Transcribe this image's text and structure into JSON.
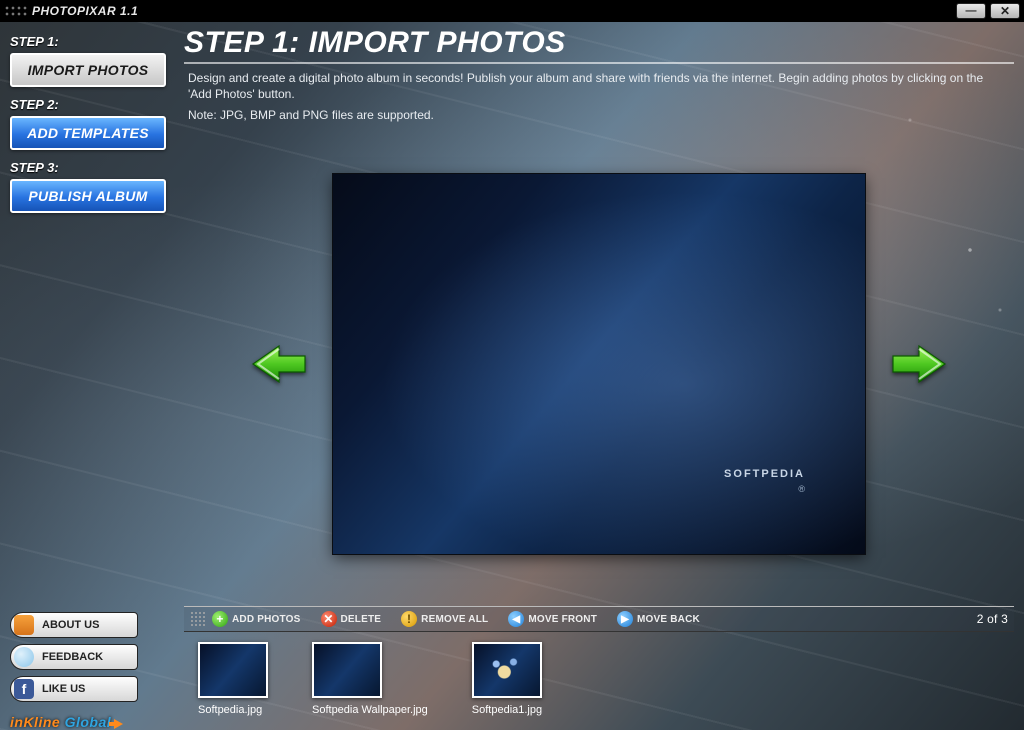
{
  "app_title": "PHOTOPIXAR 1.1",
  "sidebar": {
    "step1_label": "STEP 1:",
    "step1_btn": "IMPORT PHOTOS",
    "step2_label": "STEP 2:",
    "step2_btn": "ADD TEMPLATES",
    "step3_label": "STEP 3:",
    "step3_btn": "PUBLISH  ALBUM",
    "links": {
      "about": "ABOUT US",
      "feedback": "FEEDBACK",
      "like": "LIKE US"
    },
    "logo": {
      "part1": "inKline",
      "part2": "Global"
    }
  },
  "main": {
    "heading": "STEP 1: IMPORT PHOTOS",
    "desc": "Design and create a digital photo album in seconds! Publish your album and share with friends via the internet. Begin adding photos by clicking on the 'Add Photos' button.",
    "note": "Note: JPG, BMP and PNG files are supported.",
    "preview_brand": "SOFTPEDIA",
    "preview_sub": "®",
    "counter": "2 of 3"
  },
  "toolbar": {
    "add": "ADD PHOTOS",
    "delete": "DELETE",
    "remove": "REMOVE ALL",
    "front": "MOVE FRONT",
    "back": "MOVE BACK"
  },
  "thumbs": [
    {
      "caption": "Softpedia.jpg"
    },
    {
      "caption": "Softpedia Wallpaper.jpg"
    },
    {
      "caption": "Softpedia1.jpg"
    }
  ]
}
